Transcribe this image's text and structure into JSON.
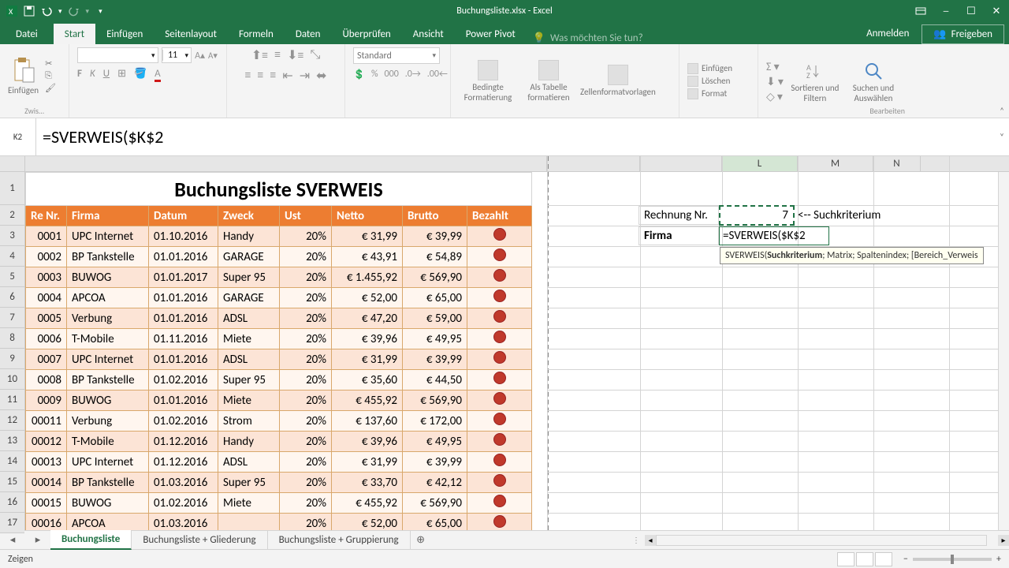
{
  "title": "Buchungsliste.xlsx - Excel",
  "qat": {
    "save": "save",
    "undo": "undo",
    "redo": "redo"
  },
  "tabs": {
    "file": "Datei",
    "start": "Start",
    "insert": "Einfügen",
    "layout": "Seitenlayout",
    "formulas": "Formeln",
    "data": "Daten",
    "review": "Überprüfen",
    "view": "Ansicht",
    "powerpivot": "Power Pivot",
    "tellme": "Was möchten Sie tun?",
    "anmelden": "Anmelden",
    "freigeben": "Freigeben"
  },
  "ribbon": {
    "clipboard_label": "Zwis…",
    "paste": "Einfügen",
    "font_size": "11",
    "number_format": "Standard",
    "cond_fmt": "Bedingte Formatierung",
    "as_table": "Als Tabelle formatieren",
    "cell_styles": "Zellenformatvorlagen",
    "insert_cells": "Einfügen",
    "delete_cells": "Löschen",
    "format_cells": "Format",
    "sort_filter": "Sortieren und Filtern",
    "find_select": "Suchen und Auswählen",
    "bearbeiten": "Bearbeiten"
  },
  "namebox": "K2",
  "formula": "=SVERWEIS($K$2",
  "colheaders_right": [
    "L",
    "M",
    "N"
  ],
  "rowheaders": [
    "1",
    "2",
    "3",
    "4",
    "5",
    "6",
    "7",
    "8",
    "9",
    "10",
    "11",
    "12",
    "13",
    "14",
    "15",
    "16",
    "17"
  ],
  "table": {
    "title": "Buchungsliste SVERWEIS",
    "headers": [
      "Re Nr.",
      "Firma",
      "Datum",
      "Zweck",
      "Ust",
      "Netto",
      "Brutto",
      "Bezahlt"
    ],
    "rows": [
      [
        "0001",
        "UPC Internet",
        "01.10.2016",
        "Handy",
        "20%",
        "€      31,99",
        "€ 39,99"
      ],
      [
        "0002",
        "BP Tankstelle",
        "01.01.2016",
        "GARAGE",
        "20%",
        "€      43,91",
        "€ 54,89"
      ],
      [
        "0003",
        "BUWOG",
        "01.01.2017",
        "Super 95",
        "20%",
        "€ 1.455,92",
        "€ 569,90"
      ],
      [
        "0004",
        "APCOA",
        "01.01.2016",
        "GARAGE",
        "20%",
        "€      52,00",
        "€ 65,00"
      ],
      [
        "0005",
        "Verbung",
        "01.01.2016",
        "ADSL",
        "20%",
        "€      47,20",
        "€ 59,00"
      ],
      [
        "0006",
        "T-Mobile",
        "01.11.2016",
        "Miete",
        "20%",
        "€      39,96",
        "€ 49,95"
      ],
      [
        "0007",
        "UPC Internet",
        "01.01.2016",
        "ADSL",
        "20%",
        "€      31,99",
        "€ 39,99"
      ],
      [
        "0008",
        "BP Tankstelle",
        "01.02.2016",
        "Super 95",
        "20%",
        "€      35,60",
        "€ 44,50"
      ],
      [
        "0009",
        "BUWOG",
        "01.01.2016",
        "Miete",
        "20%",
        "€    455,92",
        "€ 569,90"
      ],
      [
        "00011",
        "Verbung",
        "01.02.2016",
        "Strom",
        "20%",
        "€    137,60",
        "€ 172,00"
      ],
      [
        "00012",
        "T-Mobile",
        "01.12.2016",
        "Handy",
        "20%",
        "€      39,96",
        "€ 49,95"
      ],
      [
        "00013",
        "UPC Internet",
        "01.12.2016",
        "ADSL",
        "20%",
        "€      31,99",
        "€ 39,99"
      ],
      [
        "00014",
        "BP Tankstelle",
        "01.03.2016",
        "Super 95",
        "20%",
        "€      33,70",
        "€ 42,12"
      ],
      [
        "00015",
        "BUWOG",
        "01.02.2016",
        "Miete",
        "20%",
        "€    455,92",
        "€ 569,90"
      ],
      [
        "00016",
        "APCOA",
        "01.03.2016",
        "",
        "20%",
        "€      52,00",
        "€ 65,00"
      ]
    ]
  },
  "lookup": {
    "rechnr_lbl": "Rechnung Nr.",
    "rechnr_val": "7",
    "suchkrit": "<-- Suchkriterium",
    "firma_lbl": "Firma",
    "formula_disp": "=SVERWEIS($K$2",
    "tooltip_fn": "SVERWEIS(",
    "tooltip_bold": "Suchkriterium",
    "tooltip_rest": "; Matrix; Spaltenindex; [Bereich_Verweis"
  },
  "sheets": {
    "s1": "Buchungsliste",
    "s2": "Buchungsliste + Gliederung",
    "s3": "Buchungsliste + Gruppierung"
  },
  "status": "Zeigen",
  "zoom": "100 %"
}
